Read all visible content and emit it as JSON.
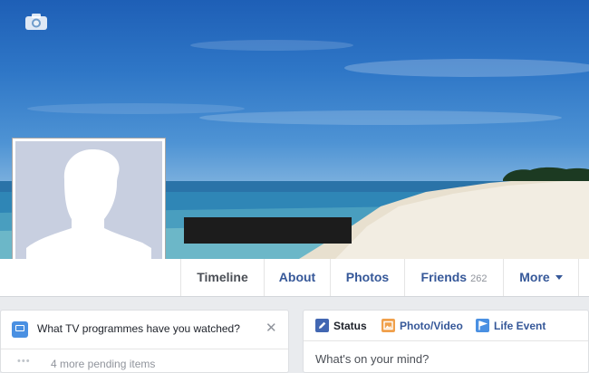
{
  "profile": {
    "camera_icon": "camera-icon",
    "avatar_icon": "default-avatar-silhouette"
  },
  "nav": {
    "tabs": [
      {
        "label": "Timeline",
        "active": true
      },
      {
        "label": "About"
      },
      {
        "label": "Photos"
      },
      {
        "label": "Friends",
        "count": "262"
      },
      {
        "label": "More"
      }
    ]
  },
  "prompt_card": {
    "icon": "tv-icon",
    "question": "What TV programmes have you watched?",
    "close_glyph": "✕",
    "dots": "•••",
    "pending": "4 more pending items"
  },
  "composer": {
    "tabs": [
      {
        "label": "Status",
        "icon": "pencil-icon",
        "color": "#4267b2"
      },
      {
        "label": "Photo/Video",
        "icon": "photo-icon",
        "color": "#f0a04b"
      },
      {
        "label": "Life Event",
        "icon": "flag-icon",
        "color": "#4a90e2"
      }
    ],
    "placeholder": "What's on your mind?"
  },
  "colors": {
    "link": "#365899",
    "background": "#e9ebee"
  }
}
